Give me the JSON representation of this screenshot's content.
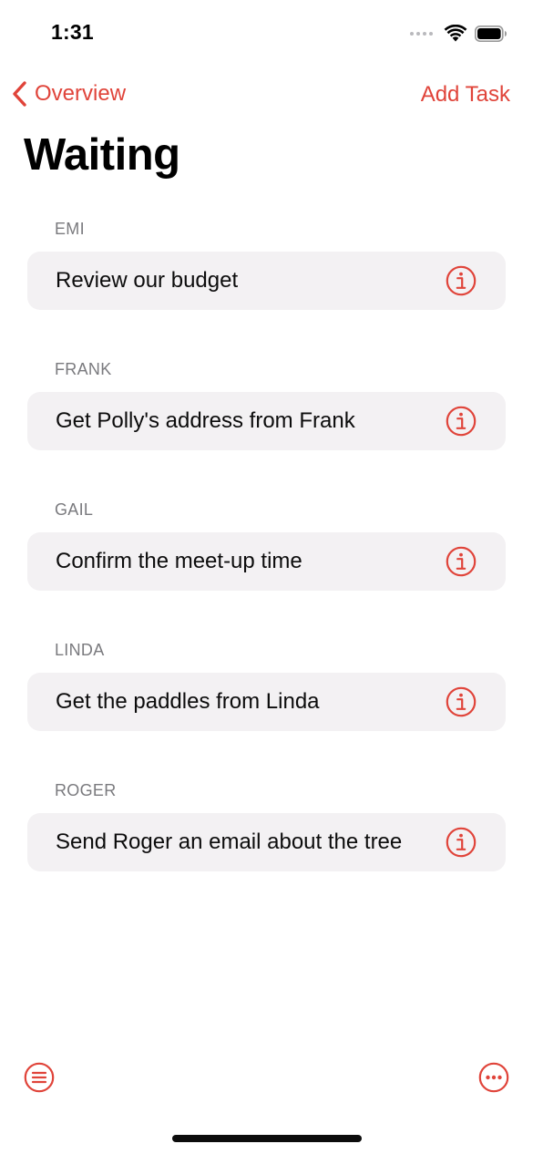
{
  "status_bar": {
    "time": "1:31"
  },
  "nav": {
    "back_label": "Overview",
    "add_task_label": "Add Task"
  },
  "page": {
    "title": "Waiting"
  },
  "sections": [
    {
      "header": "EMI",
      "task": "Review our budget"
    },
    {
      "header": "FRANK",
      "task": "Get Polly's address from Frank"
    },
    {
      "header": "GAIL",
      "task": "Confirm the meet-up time"
    },
    {
      "header": "LINDA",
      "task": "Get the paddles from Linda"
    },
    {
      "header": "ROGER",
      "task": "Send Roger an email about the tree"
    }
  ],
  "toolbar": {
    "left_icon": "list-icon",
    "right_icon": "more-icon"
  },
  "colors": {
    "accent": "#e0443a",
    "row_background": "#f3f1f3",
    "section_header": "#7a7a7e"
  }
}
